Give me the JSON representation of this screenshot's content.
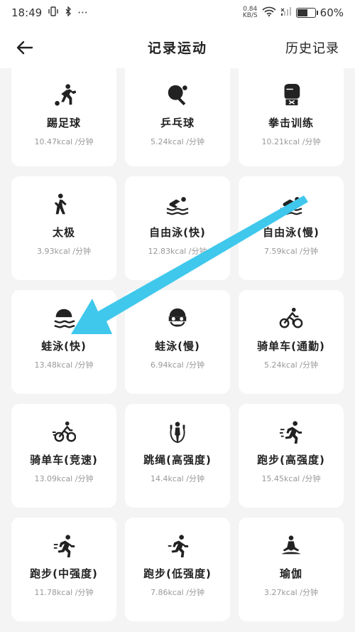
{
  "status_bar": {
    "time": "18:49",
    "dots": "···",
    "net_speed_value": "0.84",
    "net_speed_unit": "KB/S",
    "battery_percent": "60%",
    "battery_level": 0.6
  },
  "header": {
    "title": "记录运动",
    "history_label": "历史记录"
  },
  "activities": [
    {
      "name": "踢足球",
      "kcal": "10.47kcal /分钟",
      "icon": "soccer-icon"
    },
    {
      "name": "乒乓球",
      "kcal": "5.24kcal /分钟",
      "icon": "ping-pong-icon"
    },
    {
      "name": "拳击训练",
      "kcal": "10.21kcal /分钟",
      "icon": "boxing-glove-icon"
    },
    {
      "name": "太极",
      "kcal": "3.93kcal /分钟",
      "icon": "tai-chi-icon"
    },
    {
      "name": "自由泳(快)",
      "kcal": "12.83kcal /分钟",
      "icon": "freestyle-swim-icon"
    },
    {
      "name": "自由泳(慢)",
      "kcal": "7.59kcal /分钟",
      "icon": "freestyle-swim-icon"
    },
    {
      "name": "蛙泳(快)",
      "kcal": "13.48kcal /分钟",
      "icon": "breaststroke-icon"
    },
    {
      "name": "蛙泳(慢)",
      "kcal": "6.94kcal /分钟",
      "icon": "swim-goggles-icon"
    },
    {
      "name": "骑单车(通勤)",
      "kcal": "5.24kcal /分钟",
      "icon": "cycling-icon"
    },
    {
      "name": "骑单车(竞速)",
      "kcal": "13.09kcal /分钟",
      "icon": "fast-cycling-icon"
    },
    {
      "name": "跳绳(高强度)",
      "kcal": "14.4kcal /分钟",
      "icon": "jump-rope-icon"
    },
    {
      "name": "跑步(高强度)",
      "kcal": "15.45kcal /分钟",
      "icon": "running-fast-icon"
    },
    {
      "name": "跑步(中强度)",
      "kcal": "11.78kcal /分钟",
      "icon": "running-medium-icon"
    },
    {
      "name": "跑步(低强度)",
      "kcal": "7.86kcal /分钟",
      "icon": "running-slow-icon"
    },
    {
      "name": "瑜伽",
      "kcal": "3.27kcal /分钟",
      "icon": "yoga-icon"
    }
  ],
  "colors": {
    "annotation_arrow": "#3fc8ec",
    "card_background": "#ffffff",
    "page_background": "#f4f4f4",
    "secondary_text": "#999999"
  }
}
